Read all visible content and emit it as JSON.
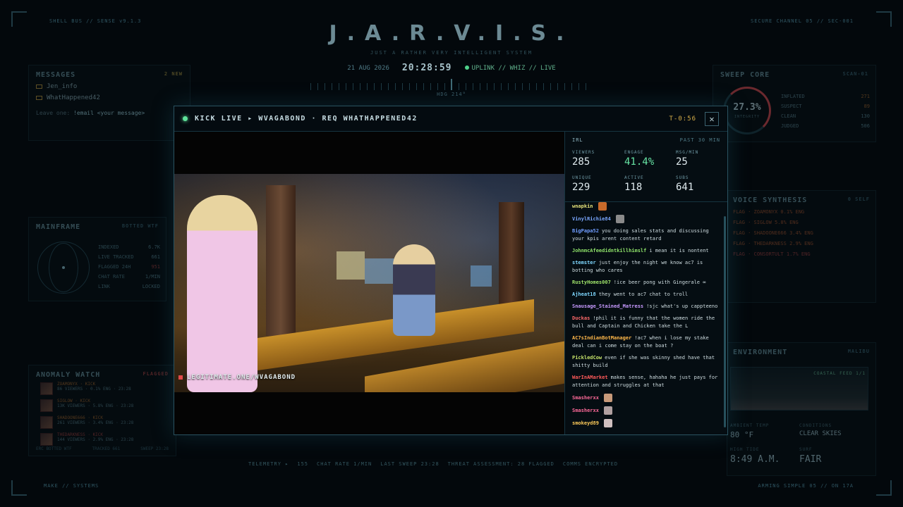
{
  "header": {
    "title": "J.A.R.V.I.S.",
    "subtitle": "JUST A RATHER VERY INTELLIGENT SYSTEM",
    "date": "21 AUG 2026",
    "time": "20:28:59",
    "status": "UPLINK // WHIZ // LIVE",
    "heading": "HDG 214°",
    "top_left": "SHELL BUS // SENSE v9.1.3",
    "top_right": "SECURE CHANNEL 05 // SEC-001",
    "bottom_left": "MAKE // SYSTEMS",
    "bottom_right": "ARMING SIMPLE 05 // ON 17A"
  },
  "messages_panel": {
    "title": "MESSAGES",
    "tag": "2 NEW",
    "items": [
      "Jen_info",
      "WhatHappened42"
    ],
    "hint_prefix": "Leave one:",
    "hint_cmd": "!email <your message>"
  },
  "mainframe_panel": {
    "title": "MAINFRAME",
    "tag": "BOTTED WTF",
    "rows": [
      {
        "label": "INDEXED",
        "value": "6.7K"
      },
      {
        "label": "LIVE TRACKED",
        "value": "661"
      },
      {
        "label": "FLAGGED 24H",
        "value": "951"
      },
      {
        "label": "CHAT RATE",
        "value": "1/MIN"
      },
      {
        "label": "LINK",
        "value": "LOCKED"
      }
    ]
  },
  "anomaly_panel": {
    "title": "ANOMALY WATCH",
    "tag": "FLAGGED",
    "rows": [
      {
        "name": "ZOAMONYX · KICK",
        "stat": "86 VIEWERS · 0.1% ENG · 23:28"
      },
      {
        "name": "SIGLOW · KICK",
        "stat": "13K VIEWERS · 5.8% ENG · 23:28"
      },
      {
        "name": "SHADOONE666 · KICK",
        "stat": "261 VIEWERS · 3.4% ENG · 23:28"
      },
      {
        "name": "THEDARKNESS · KICK",
        "stat": "144 VIEWERS · 2.9% ENG · 23:28"
      }
    ],
    "foot": [
      "ERC BOTTED WTF",
      "TRACKED 661",
      "SWEEP 23:28"
    ]
  },
  "sweep_panel": {
    "title": "SWEEP CORE",
    "tag": "SCAN-01",
    "percent": "27.3%",
    "ring_label": "INTEGRITY",
    "rows": [
      {
        "label": "INFLATED",
        "value": "271"
      },
      {
        "label": "SUSPECT",
        "value": "89"
      },
      {
        "label": "CLEAN",
        "value": "130"
      },
      {
        "label": "JUDGED",
        "value": "506"
      }
    ]
  },
  "voice_panel": {
    "title": "VOICE SYNTHESIS",
    "tag": "0 SELF",
    "rows": [
      "FLAG · ZOAMONYX 0.1% ENG",
      "FLAG · SIGLOW 5.8% ENG",
      "FLAG · SHADOONE666 3.4% ENG",
      "FLAG · THEDARKNESS 2.9% ENG",
      "FLAG · CONSORTULT 1.7% ENG"
    ]
  },
  "environment_panel": {
    "title": "ENVIRONMENT",
    "tag": "MALIBU",
    "feed_tag": "COASTAL FEED 1/1",
    "ambient_label": "AMBIENT TEMP",
    "ambient_value": "80 °F",
    "conditions_label": "CONDITIONS",
    "conditions_value": "CLEAR SKIES",
    "tide_label": "HIGH TIDE",
    "tide_value": "8:49 A.M.",
    "surf_label": "SURF",
    "surf_value": "FAIR"
  },
  "telemetry": [
    "TELEMETRY ▸",
    "155",
    "CHAT RATE 1/MIN",
    "LAST SWEEP 23:28",
    "THREAT ASSESSMENT: 28 FLAGGED",
    "COMMS ENCRYPTED"
  ],
  "window": {
    "title": "KICK LIVE ▸ WVAGABOND · REQ WHATHAPPENED42",
    "timer": "T-0:56",
    "close": "✕",
    "watermark": "LEGITIMATE.ONE/WVAGABOND",
    "stats": {
      "category": "IRL",
      "period": "PAST 30 MIN",
      "items": [
        {
          "label": "VIEWERS",
          "value": "285"
        },
        {
          "label": "ENGAGE",
          "value": "41.4%"
        },
        {
          "label": "MSG/MIN",
          "value": "25"
        },
        {
          "label": "UNIQUE",
          "value": "229"
        },
        {
          "label": "ACTIVE",
          "value": "118"
        },
        {
          "label": "SUBS",
          "value": "641"
        }
      ]
    },
    "chat": [
      {
        "user": "wnapkin",
        "color": "#e5e27a",
        "text": "",
        "emote": "#c86a2a"
      },
      {
        "user": "VinylRichie84",
        "color": "#7aa7ff",
        "text": "",
        "emote": "#8a8a8a"
      },
      {
        "user": "BigPapa52",
        "color": "#6f9cff",
        "text": "you doing sales stats and discussing your kpis arent content retard"
      },
      {
        "user": "JohnmcAfeedidntkillhimslf",
        "color": "#8fe36a",
        "text": "i mean it is nontent"
      },
      {
        "user": "stemster",
        "color": "#7fd8ff",
        "text": "just enjoy the night we know ac7 is botting who cares"
      },
      {
        "user": "RustyHomes007",
        "color": "#9fe36a",
        "text": "!ice beer pong with Gingerale ∞"
      },
      {
        "user": "Ajheat18",
        "color": "#7fd8ff",
        "text": "they went to ac7 chat to troll"
      },
      {
        "user": "Snausage_Stained_Matress",
        "color": "#c79aff",
        "text": "!sjc what's up cappteeno"
      },
      {
        "user": "Duckas",
        "color": "#ff6a6a",
        "text": "!phil it is funny that the women ride the bull and Captain and Chicken take the L"
      },
      {
        "user": "AC7sIndianBotManager",
        "color": "#ffb84a",
        "text": "!ac7 when i lose my stake deal can i come stay on the boat ?"
      },
      {
        "user": "PickledCow",
        "color": "#c6e36a",
        "text": "even if she was skinny shed have that shitty build"
      },
      {
        "user": "WarInAMarket",
        "color": "#ff5a5a",
        "text": "makes sense, hahaha he just pays for attention and struggles at that"
      },
      {
        "user": "Smasherxx",
        "color": "#ff6a9a",
        "text": "",
        "emote": "#c89a7a"
      },
      {
        "user": "Smasherxx",
        "color": "#ff6a9a",
        "text": "",
        "emote": "#b0a0a0"
      },
      {
        "user": "smokeyd89",
        "color": "#ffcc5a",
        "text": "",
        "emote": "#d0c0c0"
      }
    ]
  }
}
